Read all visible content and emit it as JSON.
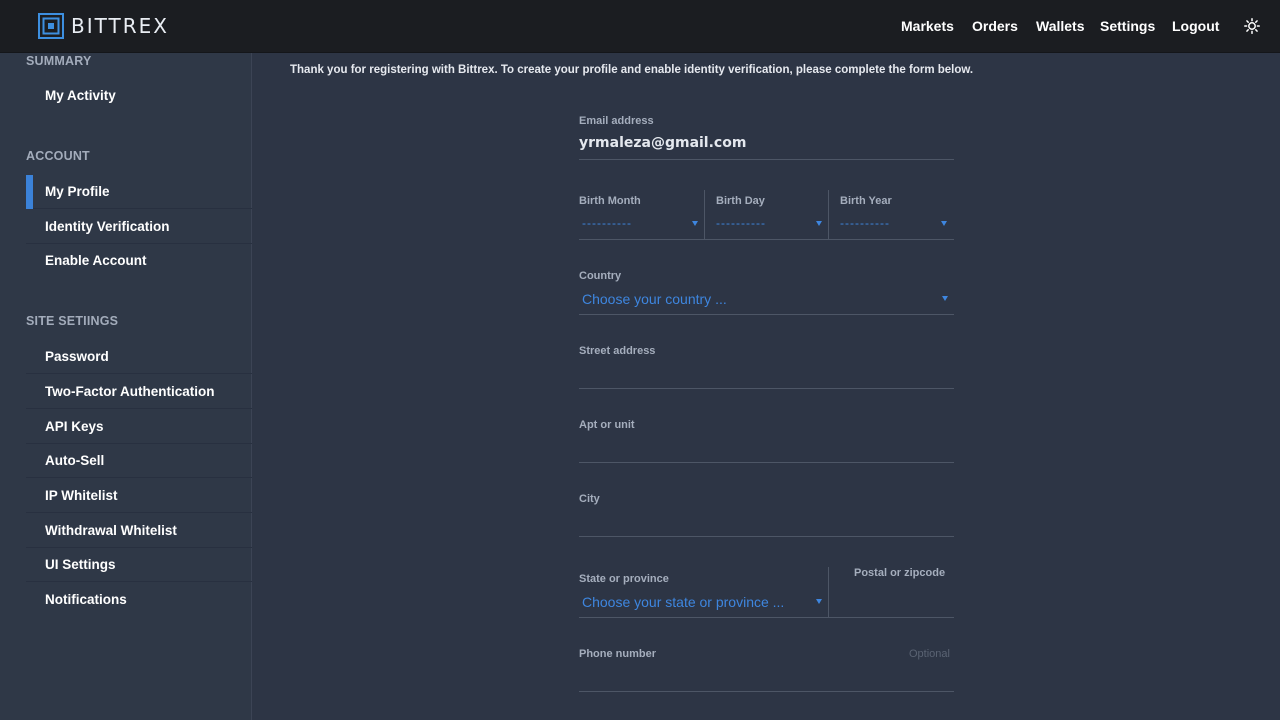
{
  "app": {
    "brand": "BITTREX"
  },
  "nav": {
    "markets": "Markets",
    "orders": "Orders",
    "wallets": "Wallets",
    "settings": "Settings",
    "logout": "Logout"
  },
  "sidebar": {
    "summary_heading": "SUMMARY",
    "summary_items": [
      "My Activity"
    ],
    "account_heading": "ACCOUNT",
    "account_items": [
      "My Profile",
      "Identity Verification",
      "Enable Account"
    ],
    "site_heading": "SITE SETIINGS",
    "site_items": [
      "Password",
      "Two-Factor Authentication",
      "API Keys",
      "Auto-Sell",
      "IP Whitelist",
      "Withdrawal Whitelist",
      "UI Settings",
      "Notifications"
    ],
    "active_item": "My Profile"
  },
  "form": {
    "intro": "Thank you for registering with Bittrex. To create your profile and enable identity verification, please complete the form below.",
    "email_label": "Email address",
    "email_value": "yrmaleza@gmail.com",
    "birth_month_label": "Birth Month",
    "birth_day_label": "Birth Day",
    "birth_year_label": "Birth Year",
    "birth_month_value": "----------",
    "birth_day_value": "----------",
    "birth_year_value": "----------",
    "country_label": "Country",
    "country_placeholder": "Choose your country ...",
    "street_label": "Street address",
    "apt_label": "Apt or unit",
    "city_label": "City",
    "state_label": "State or province",
    "state_placeholder": "Choose your state or province ...",
    "postal_label": "Postal or zipcode",
    "phone_label": "Phone number",
    "phone_optional": "Optional"
  },
  "colors": {
    "accent": "#3b82d9",
    "topbar": "#1b1d21",
    "background": "#2d3545"
  },
  "icons": {
    "logo": "bittrex-logo-icon",
    "theme": "sun-icon",
    "dropdown": "caret-down-icon"
  }
}
